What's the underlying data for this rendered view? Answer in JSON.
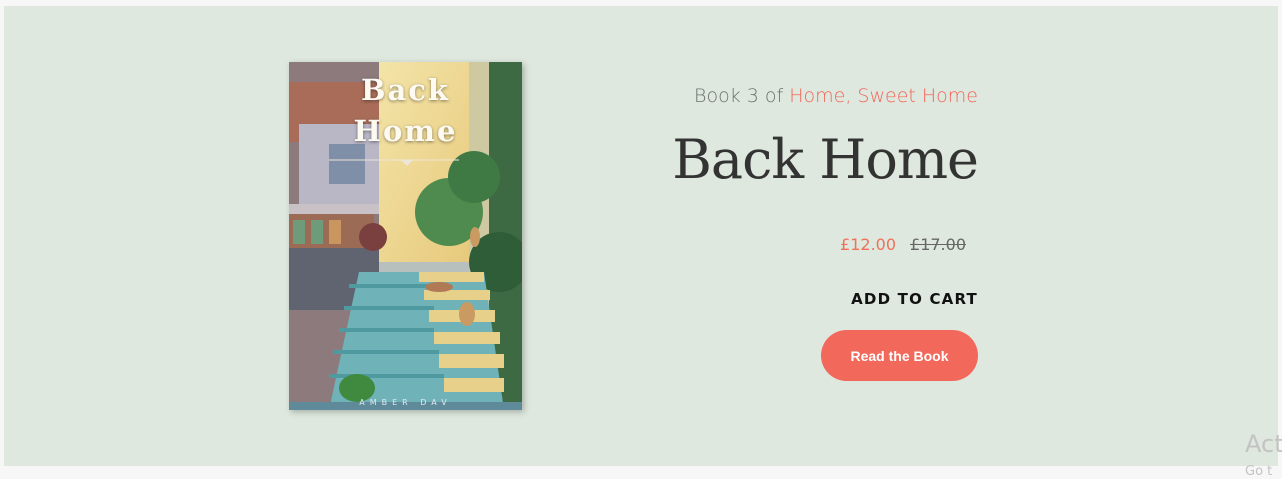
{
  "book": {
    "cover": {
      "title": "Back\nHome",
      "author": "AMBER DAV"
    },
    "series": {
      "prefix": "Book 3 of ",
      "name": "Home, Sweet Home"
    },
    "title": "Back Home",
    "price": {
      "sale": "£12.00",
      "original": "£17.00"
    },
    "add_to_cart_label": "ADD TO CART",
    "read_button_label": "Read the Book"
  },
  "colors": {
    "panel_bg": "#dee8de",
    "accent": "#f2685a",
    "title_text": "#333333"
  },
  "watermark": {
    "line1": "Act",
    "line2": "Go t"
  }
}
